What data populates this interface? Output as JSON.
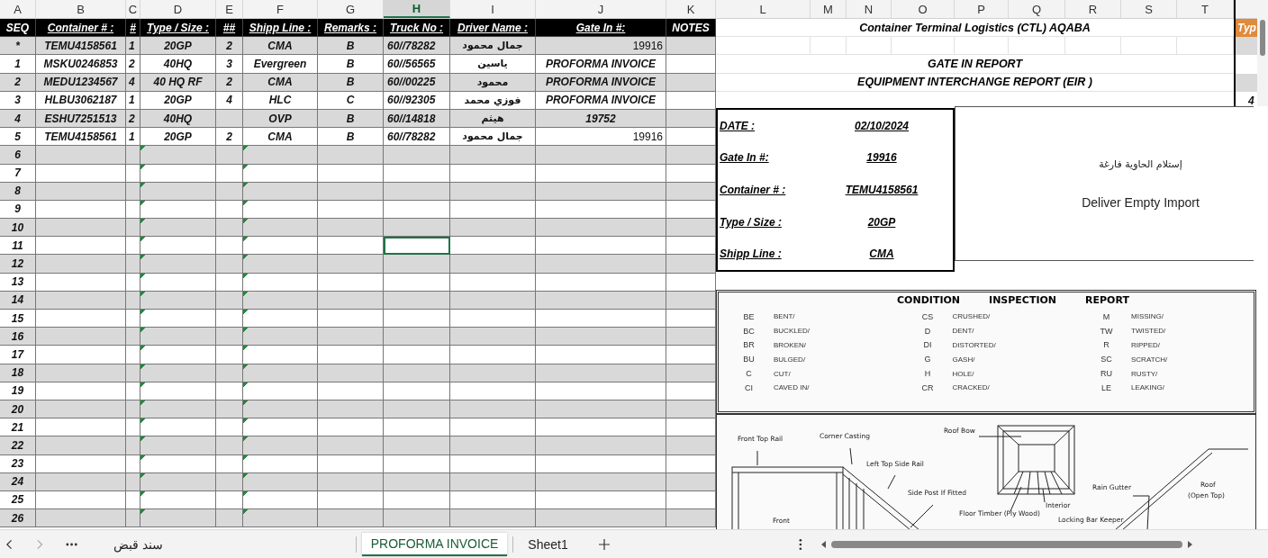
{
  "column_headers": [
    {
      "label": "A",
      "selected": false
    },
    {
      "label": "B",
      "selected": false
    },
    {
      "label": "C",
      "selected": false
    },
    {
      "label": "D",
      "selected": false
    },
    {
      "label": "E",
      "selected": false
    },
    {
      "label": "F",
      "selected": false
    },
    {
      "label": "G",
      "selected": false
    },
    {
      "label": "H",
      "selected": true
    },
    {
      "label": "I",
      "selected": false
    },
    {
      "label": "J",
      "selected": false
    },
    {
      "label": "K",
      "selected": false
    },
    {
      "label": "L",
      "selected": false
    },
    {
      "label": "M",
      "selected": false
    },
    {
      "label": "N",
      "selected": false
    },
    {
      "label": "O",
      "selected": false
    },
    {
      "label": "P",
      "selected": false
    },
    {
      "label": "Q",
      "selected": false
    },
    {
      "label": "R",
      "selected": false
    },
    {
      "label": "S",
      "selected": false
    },
    {
      "label": "T",
      "selected": false
    }
  ],
  "table": {
    "columns": [
      {
        "label": "SEQ",
        "underlined": false
      },
      {
        "label": "Container # :",
        "underlined": true
      },
      {
        "label": "#",
        "underlined": true
      },
      {
        "label": "Type / Size :",
        "underlined": true
      },
      {
        "label": "##",
        "underlined": true
      },
      {
        "label": "Shipp Line :",
        "underlined": true
      },
      {
        "label": "Remarks :",
        "underlined": true
      },
      {
        "label": "Truck No :",
        "underlined": true
      },
      {
        "label": "Driver Name :",
        "underlined": true
      },
      {
        "label": "Gate In #:",
        "underlined": true
      },
      {
        "label": "NOTES",
        "underlined": false
      }
    ],
    "rows": [
      {
        "seq": "*",
        "container": "TEMU4158561",
        "qty": "1",
        "type_size": "20GP",
        "count": "2",
        "line": "CMA",
        "remarks": "B",
        "truck": "60//78282",
        "driver": "جمال محمود",
        "gate_in": {
          "text": "19916",
          "kind": "number"
        }
      },
      {
        "seq": "1",
        "container": "MSKU0246853",
        "qty": "2",
        "type_size": "40HQ",
        "count": "3",
        "line": "Evergreen",
        "remarks": "B",
        "truck": "60//56565",
        "driver": "ياسين",
        "gate_in": {
          "text": "PROFORMA INVOICE",
          "kind": "text"
        }
      },
      {
        "seq": "2",
        "container": "MEDU1234567",
        "qty": "4",
        "type_size": "40 HQ RF",
        "count": "2",
        "line": "CMA",
        "remarks": "B",
        "truck": "60//00225",
        "driver": "محمود",
        "gate_in": {
          "text": "PROFORMA INVOICE",
          "kind": "text"
        }
      },
      {
        "seq": "3",
        "container": "HLBU3062187",
        "qty": "1",
        "type_size": "20GP",
        "count": "4",
        "line": "HLC",
        "remarks": "C",
        "truck": "60//92305",
        "driver": "فوزي محمد",
        "gate_in": {
          "text": "PROFORMA INVOICE",
          "kind": "text"
        }
      },
      {
        "seq": "4",
        "container": "ESHU7251513",
        "qty": "2",
        "type_size": "40HQ",
        "line": "OVP",
        "remarks": "B",
        "truck": "60//14818",
        "driver": "هيثم",
        "gate_in": {
          "text": "19752",
          "kind": "text"
        }
      },
      {
        "seq": "5",
        "container": "TEMU4158561",
        "qty": "1",
        "type_size": "20GP",
        "count": "2",
        "line": "CMA",
        "remarks": "B",
        "truck": "60//78282",
        "driver": "جمال محمود",
        "gate_in": {
          "text": "19916",
          "kind": "number"
        }
      }
    ],
    "empty_rows": [
      {
        "seq": "6",
        "selected": false
      },
      {
        "seq": "7",
        "selected": false
      },
      {
        "seq": "8",
        "selected": false
      },
      {
        "seq": "9",
        "selected": false
      },
      {
        "seq": "10",
        "selected": false
      },
      {
        "seq": "11",
        "selected": true
      },
      {
        "seq": "12",
        "selected": false
      },
      {
        "seq": "13",
        "selected": false
      },
      {
        "seq": "14",
        "selected": false
      },
      {
        "seq": "15",
        "selected": false
      },
      {
        "seq": "16",
        "selected": false
      },
      {
        "seq": "17",
        "selected": false
      },
      {
        "seq": "18",
        "selected": false
      },
      {
        "seq": "19",
        "selected": false
      },
      {
        "seq": "20",
        "selected": false
      },
      {
        "seq": "21",
        "selected": false
      },
      {
        "seq": "22",
        "selected": false
      },
      {
        "seq": "23",
        "selected": false
      },
      {
        "seq": "24",
        "selected": false
      },
      {
        "seq": "25",
        "selected": false
      },
      {
        "seq": "26",
        "selected": false
      }
    ]
  },
  "report": {
    "title": "Container Terminal Logistics (CTL) AQABA",
    "subtitle": "GATE IN REPORT",
    "eir_title": "EQUIPMENT INTERCHANGE REPORT (EIR  )",
    "details": [
      {
        "label": "DATE :",
        "value": "02/10/2024"
      },
      {
        "label": "Gate In #:",
        "value": "19916"
      },
      {
        "label": "Container # :",
        "value": "TEMU4158561"
      },
      {
        "label": "Type / Size :",
        "value": "20GP"
      },
      {
        "label": "Shipp Line :",
        "value": "CMA"
      }
    ],
    "note_arabic": "إستلام الحاوية فارغة",
    "note": "Deliver Empty Import"
  },
  "side_column": {
    "header": "Typ",
    "value": "4"
  },
  "condition_report": {
    "title_words": [
      "CONDITION",
      "INSPECTION",
      "REPORT"
    ],
    "groups": [
      [
        {
          "code": "BE",
          "meaning": "BENT/"
        },
        {
          "code": "BC",
          "meaning": "BUCKLED/"
        },
        {
          "code": "BR",
          "meaning": "BROKEN/"
        },
        {
          "code": "BU",
          "meaning": "BULGED/"
        },
        {
          "code": "C",
          "meaning": "CUT/"
        },
        {
          "code": "CI",
          "meaning": "CAVED IN/"
        }
      ],
      [
        {
          "code": "CS",
          "meaning": "CRUSHED/"
        },
        {
          "code": "D",
          "meaning": "DENT/"
        },
        {
          "code": "DI",
          "meaning": "DISTORTED/"
        },
        {
          "code": "G",
          "meaning": "GASH/"
        },
        {
          "code": "H",
          "meaning": "HOLE/"
        },
        {
          "code": "CR",
          "meaning": "CRACKED/"
        }
      ],
      [
        {
          "code": "M",
          "meaning": "MISSING/"
        },
        {
          "code": "TW",
          "meaning": "TWISTED/"
        },
        {
          "code": "R",
          "meaning": "RIPPED/"
        },
        {
          "code": "SC",
          "meaning": "SCRATCH/"
        },
        {
          "code": "RU",
          "meaning": "RUSTY/"
        },
        {
          "code": "LE",
          "meaning": "LEAKING/"
        }
      ]
    ]
  },
  "diagram": {
    "labels": [
      "Front Top Rail",
      "Corner Casting",
      "Roof Bow",
      "Left Top Side Rail",
      "Side Post If Fitted",
      "Rain Gutter",
      "Roof",
      "(Open Top)",
      "Interior",
      "Floor Timber (Ply Wood)",
      "Front",
      "Locking Bar Keeper"
    ]
  },
  "sheet_tabs": [
    {
      "label": "سند قبض",
      "selected": false
    },
    {
      "label": "PROFORMA INVOICE",
      "selected": true
    },
    {
      "label": "Sheet1",
      "selected": false
    }
  ]
}
